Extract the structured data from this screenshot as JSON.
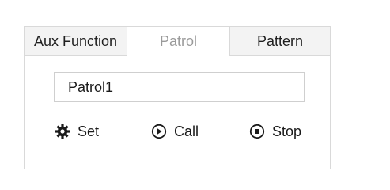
{
  "tabs": [
    {
      "label": "Aux Function",
      "active": false
    },
    {
      "label": "Patrol",
      "active": true
    },
    {
      "label": "Pattern",
      "active": false
    }
  ],
  "patrol_select": {
    "value": "Patrol1"
  },
  "actions": {
    "set_label": "Set",
    "call_label": "Call",
    "stop_label": "Stop"
  },
  "icons": {
    "set": "gear-icon",
    "call": "play-circle-icon",
    "stop": "stop-circle-icon"
  },
  "colors": {
    "active_tab_text": "#9a9a9a",
    "inactive_tab_bg": "#f3f3f3",
    "border": "#d9d9d9",
    "text": "#1a1a1a"
  }
}
